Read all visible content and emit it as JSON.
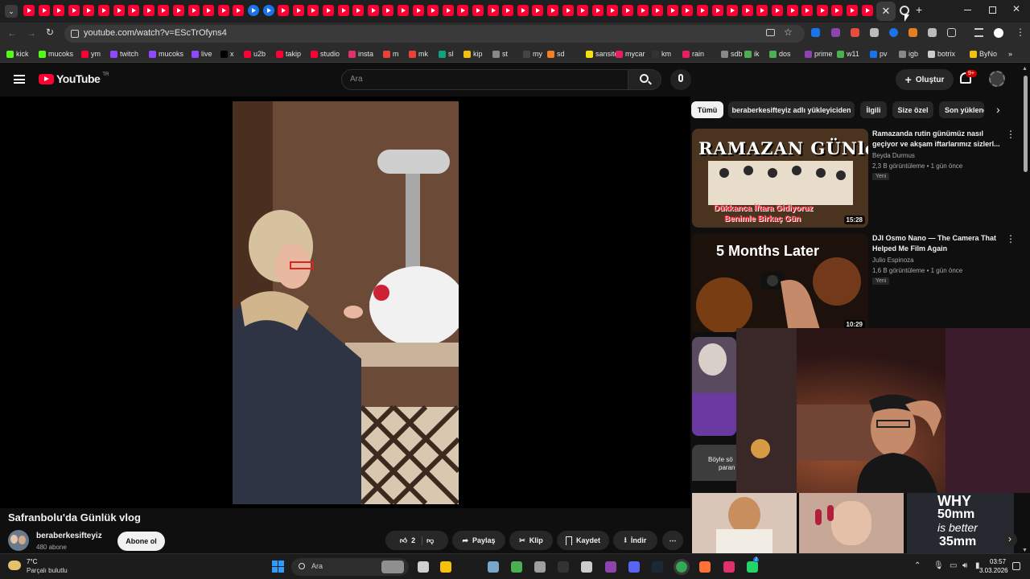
{
  "browser": {
    "url": "youtube.com/watch?v=EScTrOfyns4",
    "active_tab_close": "✕",
    "new_tab": "+",
    "bookmarks": [
      {
        "label": "kick",
        "color": "#53fc18"
      },
      {
        "label": "mucoks",
        "color": "#53fc18"
      },
      {
        "label": "ym",
        "color": "#ff0033"
      },
      {
        "label": "twitch",
        "color": "#9146ff"
      },
      {
        "label": "mucoks",
        "color": "#9146ff"
      },
      {
        "label": "live",
        "color": "#9146ff"
      },
      {
        "label": "x",
        "color": "#000000"
      },
      {
        "label": "u2b",
        "color": "#ff0033"
      },
      {
        "label": "takip",
        "color": "#ff0033"
      },
      {
        "label": "studio",
        "color": "#ff0033"
      },
      {
        "label": "insta",
        "color": "#e1306c"
      },
      {
        "label": "m",
        "color": "#ea4335"
      },
      {
        "label": "mk",
        "color": "#ea4335"
      },
      {
        "label": "sl",
        "color": "#10a37f"
      },
      {
        "label": "kip",
        "color": "#f4c20d"
      },
      {
        "label": "st",
        "color": "#888888"
      },
      {
        "label": "my",
        "color": "#444444"
      },
      {
        "label": "sd",
        "color": "#f48024"
      },
      {
        "label": "sansite",
        "color": "#f4e20d"
      },
      {
        "label": "mycar",
        "color": "#e91e63"
      },
      {
        "label": "km",
        "color": "#333333"
      },
      {
        "label": "rain",
        "color": "#e91e63"
      },
      {
        "label": "sdb",
        "color": "#888888"
      },
      {
        "label": "ik",
        "color": "#4caf50"
      },
      {
        "label": "dos",
        "color": "#4caf50"
      },
      {
        "label": "prime",
        "color": "#8e44ad"
      },
      {
        "label": "w11",
        "color": "#4caf50"
      },
      {
        "label": "pv",
        "color": "#1a73e8"
      },
      {
        "label": "igb",
        "color": "#888888"
      },
      {
        "label": "botrix",
        "color": "#cccccc"
      },
      {
        "label": "ByNo",
        "color": "#f4c20d"
      }
    ]
  },
  "youtube": {
    "logo_text": "YouTube",
    "logo_region": "TR",
    "search_placeholder": "Ara",
    "create_label": "Oluştur",
    "notifications_count": "9+",
    "chips": [
      "Tümü",
      "beraberkesifteyiz adlı yükleyiciden",
      "İlgili",
      "Size özel",
      "Son yüklene"
    ],
    "video": {
      "title": "Safranbolu'da Günlük vlog",
      "channel": "beraberkesifteyiz",
      "subscribers": "480 abone",
      "subscribe_label": "Abone ol",
      "likes": "2",
      "share_label": "Paylaş",
      "clip_label": "Klip",
      "save_label": "Kaydet",
      "download_label": "İndir"
    },
    "recommendations": [
      {
        "title": "Ramazanda rutin günümüz nasıl geçiyor ve akşam iftarlarımız sizlerl...",
        "channel": "Beyda Durmus",
        "meta": "2,3 B görüntüleme • 1 gün önce",
        "badge": "Yeni",
        "duration": "15:28",
        "thumb_top": "RAMAZAN GÜNleri",
        "thumb_bottom_1": "Dükkanca İftara Gidiyoruz",
        "thumb_bottom_2": "Benimle Birkaç Gün"
      },
      {
        "title": "DJI Osmo Nano — The Camera That Helped Me Film Again",
        "channel": "Julio Espinoza",
        "meta": "1,6 B görüntüleme • 1 gün önce",
        "badge": "Yeni",
        "duration": "10:29",
        "thumb_top": "5 Months Later"
      }
    ],
    "shorts_partial": {
      "text_line1": "Böyle sö",
      "text_line2": "paran",
      "short3_line1": "WHY",
      "short3_line2": "50mm",
      "short3_line3": "is better",
      "short3_line4": "35mm"
    }
  },
  "taskbar": {
    "weather_temp": "7°C",
    "weather_desc": "Parçalı bulutlu",
    "search_label": "Ara",
    "time": "03:57",
    "date": "3.03.2026",
    "whatsapp_badge": "2"
  }
}
